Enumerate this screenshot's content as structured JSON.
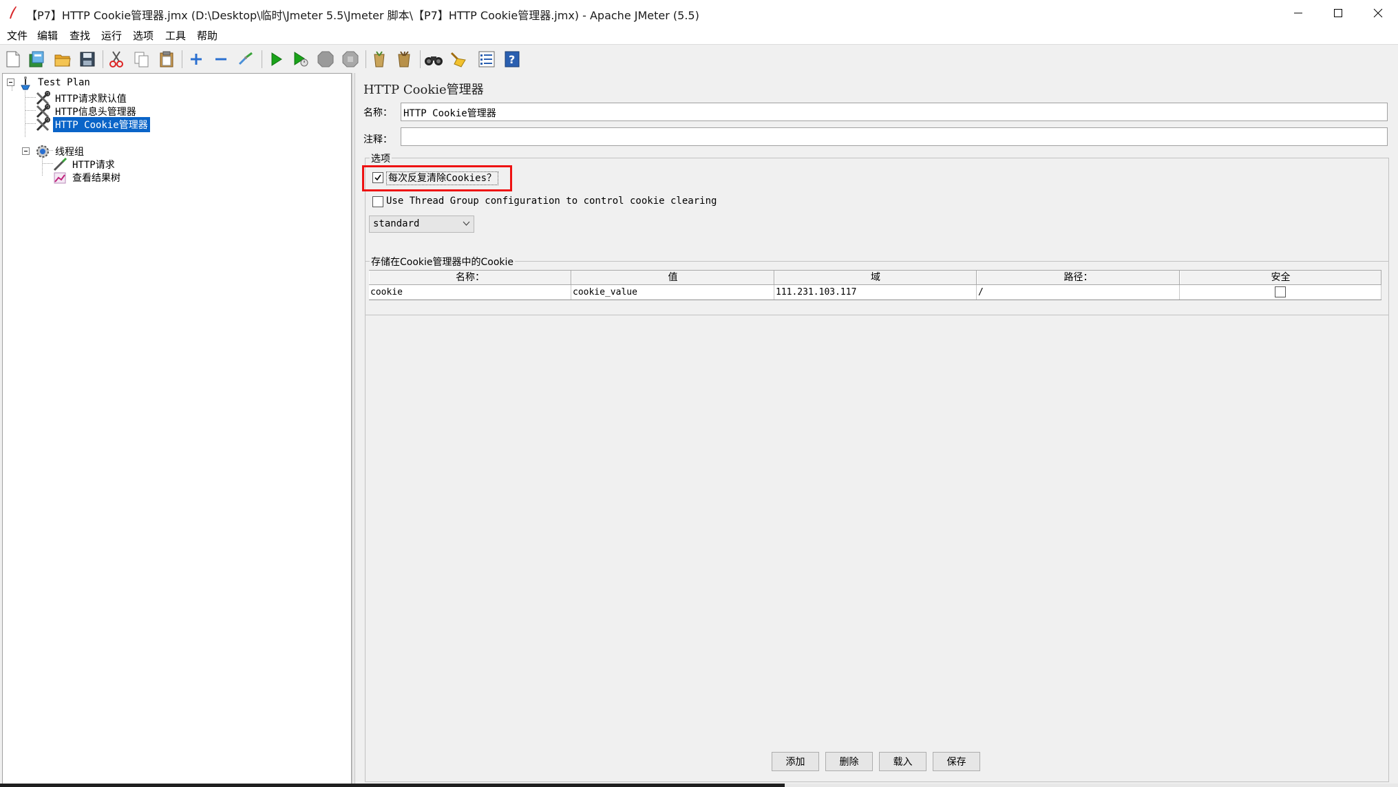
{
  "window": {
    "title": "【P7】HTTP Cookie管理器.jmx (D:\\Desktop\\临时\\Jmeter 5.5\\Jmeter 脚本\\【P7】HTTP Cookie管理器.jmx) - Apache JMeter (5.5)"
  },
  "menu": {
    "items": [
      "文件",
      "编辑",
      "查找",
      "运行",
      "选项",
      "工具",
      "帮助"
    ]
  },
  "toolbar": {
    "icons": [
      "new-icon",
      "templates-icon",
      "open-icon",
      "save-icon",
      "cut-icon",
      "copy-icon",
      "paste-icon",
      "expand-icon",
      "collapse-icon",
      "toggle-icon",
      "start-icon",
      "start-no-timers-icon",
      "stop-icon",
      "shutdown-icon",
      "clear-icon",
      "clear-all-icon",
      "search-icon",
      "reset-search-icon",
      "function-helper-icon",
      "help-icon"
    ]
  },
  "tree": {
    "items": [
      {
        "label": "Test Plan",
        "icon": "test-plan-icon"
      },
      {
        "label": "HTTP请求默认值",
        "icon": "config-element-icon"
      },
      {
        "label": "HTTP信息头管理器",
        "icon": "config-element-icon"
      },
      {
        "label": "HTTP Cookie管理器",
        "icon": "config-element-icon",
        "selected": true
      },
      {
        "label": "线程组",
        "icon": "thread-group-icon"
      },
      {
        "label": "HTTP请求",
        "icon": "sampler-icon"
      },
      {
        "label": "查看结果树",
        "icon": "listener-icon"
      }
    ]
  },
  "panel": {
    "title": "HTTP Cookie管理器",
    "name_label": "名称：",
    "name_value": "HTTP Cookie管理器",
    "comment_label": "注释：",
    "comment_value": "",
    "options": {
      "legend": "选项",
      "clear_each_iteration_label": "每次反复清除Cookies？",
      "clear_each_iteration_checked": true,
      "use_thread_group_label": "Use Thread Group configuration to control cookie clearing",
      "use_thread_group_checked": false,
      "policy_value": "standard"
    },
    "cookies": {
      "legend": "存储在Cookie管理器中的Cookie",
      "headers": [
        "名称：",
        "值",
        "域",
        "路径：",
        "安全"
      ],
      "rows": [
        {
          "name": "cookie",
          "value": "cookie_value",
          "domain": "111.231.103.117",
          "path": "/",
          "secure": false
        }
      ]
    },
    "buttons": {
      "add": "添加",
      "delete": "删除",
      "load": "载入",
      "save": "保存"
    }
  },
  "colors": {
    "selection": "#0a64c8",
    "highlight_box": "#ee1111",
    "start_green": "#1aa31a"
  }
}
